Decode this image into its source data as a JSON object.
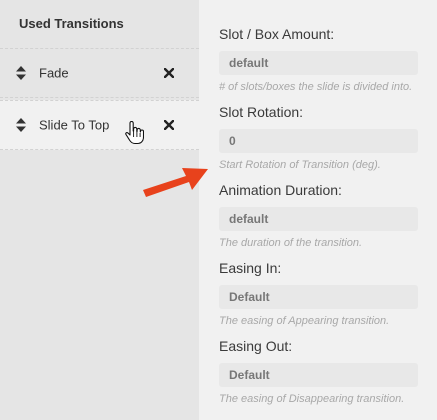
{
  "sidebar": {
    "title": "Used Transitions",
    "items": [
      {
        "label": "Fade"
      },
      {
        "label": "Slide To Top"
      }
    ]
  },
  "settings": {
    "slot_amount": {
      "label": "Slot / Box Amount:",
      "value": "default",
      "hint": "# of slots/boxes the slide is divided into."
    },
    "slot_rotation": {
      "label": "Slot Rotation:",
      "value": "0",
      "hint": "Start Rotation of Transition (deg)."
    },
    "duration": {
      "label": "Animation Duration:",
      "value": "default",
      "hint": "The duration of the transition."
    },
    "easing_in": {
      "label": "Easing In:",
      "value": "Default",
      "hint": "The easing of Appearing transition."
    },
    "easing_out": {
      "label": "Easing Out:",
      "value": "Default",
      "hint": "The easing of Disappearing transition."
    }
  },
  "colors": {
    "arrow": "#e8421c",
    "panel": "#f1f1f1",
    "sidebar": "#e5e5e5"
  },
  "icons": [
    "sort-arrows-icon",
    "remove-x-icon",
    "hand-pointer-cursor-icon",
    "red-arrow-annotation"
  ]
}
